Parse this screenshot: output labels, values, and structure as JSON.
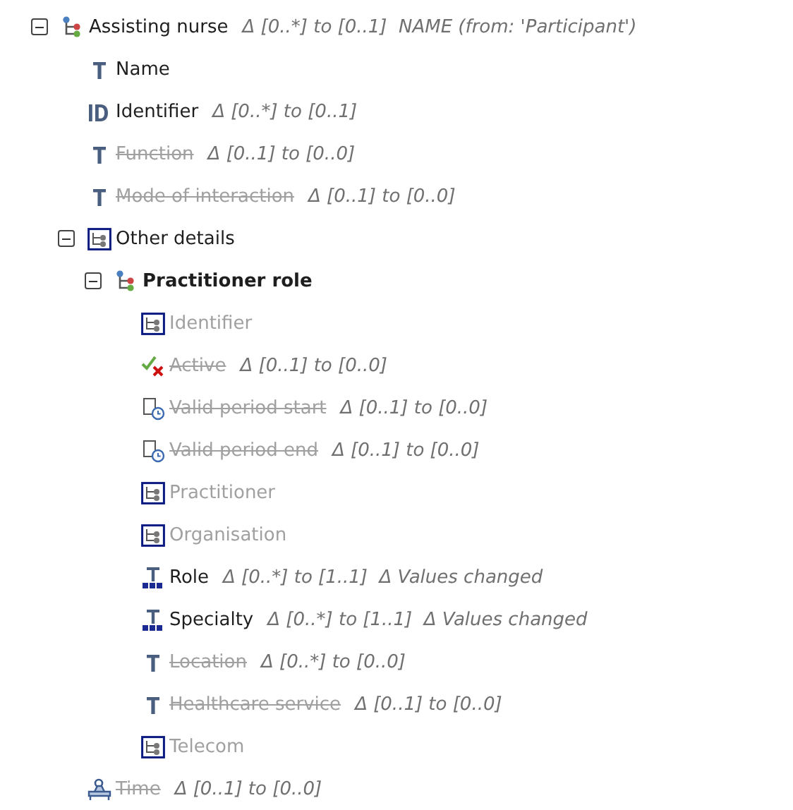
{
  "tree": [
    {
      "label": "Assisting nurse",
      "kind": "cluster",
      "expanded": true,
      "removed": false,
      "greyed": false,
      "bold": false,
      "note": "Δ [0..*] to [0..1]  NAME (from: 'Participant')",
      "children": [
        {
          "label": "Name",
          "kind": "text",
          "removed": false,
          "greyed": false,
          "bold": false
        },
        {
          "label": "Identifier",
          "kind": "id",
          "removed": false,
          "greyed": false,
          "bold": false,
          "note": "Δ [0..*] to [0..1]"
        },
        {
          "label": "Function",
          "kind": "text",
          "removed": true,
          "greyed": true,
          "bold": false,
          "note": "Δ [0..1] to [0..0]"
        },
        {
          "label": "Mode of interaction",
          "kind": "text",
          "removed": true,
          "greyed": true,
          "bold": false,
          "note": "Δ [0..1] to [0..0]"
        },
        {
          "label": "Other details",
          "kind": "element",
          "expanded": true,
          "removed": false,
          "greyed": false,
          "bold": false,
          "children": [
            {
              "label": "Practitioner role",
              "kind": "cluster",
              "expanded": true,
              "removed": false,
              "greyed": false,
              "bold": true,
              "children": [
                {
                  "label": "Identifier",
                  "kind": "element",
                  "removed": false,
                  "greyed": true,
                  "bold": false
                },
                {
                  "label": "Active",
                  "kind": "boolean",
                  "removed": true,
                  "greyed": true,
                  "bold": false,
                  "note": "Δ [0..1] to [0..0]"
                },
                {
                  "label": "Valid period start",
                  "kind": "datetime",
                  "removed": true,
                  "greyed": true,
                  "bold": false,
                  "note": "Δ [0..1] to [0..0]"
                },
                {
                  "label": "Valid period end",
                  "kind": "datetime",
                  "removed": true,
                  "greyed": true,
                  "bold": false,
                  "note": "Δ [0..1] to [0..0]"
                },
                {
                  "label": "Practitioner",
                  "kind": "element",
                  "removed": false,
                  "greyed": true,
                  "bold": false
                },
                {
                  "label": "Organisation",
                  "kind": "element",
                  "removed": false,
                  "greyed": true,
                  "bold": false
                },
                {
                  "label": "Role",
                  "kind": "coded",
                  "removed": false,
                  "greyed": false,
                  "bold": false,
                  "note": "Δ [0..*] to [1..1]  Δ Values changed"
                },
                {
                  "label": "Specialty",
                  "kind": "coded",
                  "removed": false,
                  "greyed": false,
                  "bold": false,
                  "note": "Δ [0..*] to [1..1]  Δ Values changed"
                },
                {
                  "label": "Location",
                  "kind": "text",
                  "removed": true,
                  "greyed": true,
                  "bold": false,
                  "note": "Δ [0..*] to [0..0]"
                },
                {
                  "label": "Healthcare service",
                  "kind": "text",
                  "removed": true,
                  "greyed": true,
                  "bold": false,
                  "note": "Δ [0..1] to [0..0]"
                },
                {
                  "label": "Telecom",
                  "kind": "element",
                  "removed": false,
                  "greyed": true,
                  "bold": false
                }
              ]
            }
          ]
        },
        {
          "label": "Time",
          "kind": "slot",
          "removed": true,
          "greyed": true,
          "bold": false,
          "note": "Δ [0..1] to [0..0]"
        }
      ]
    }
  ]
}
